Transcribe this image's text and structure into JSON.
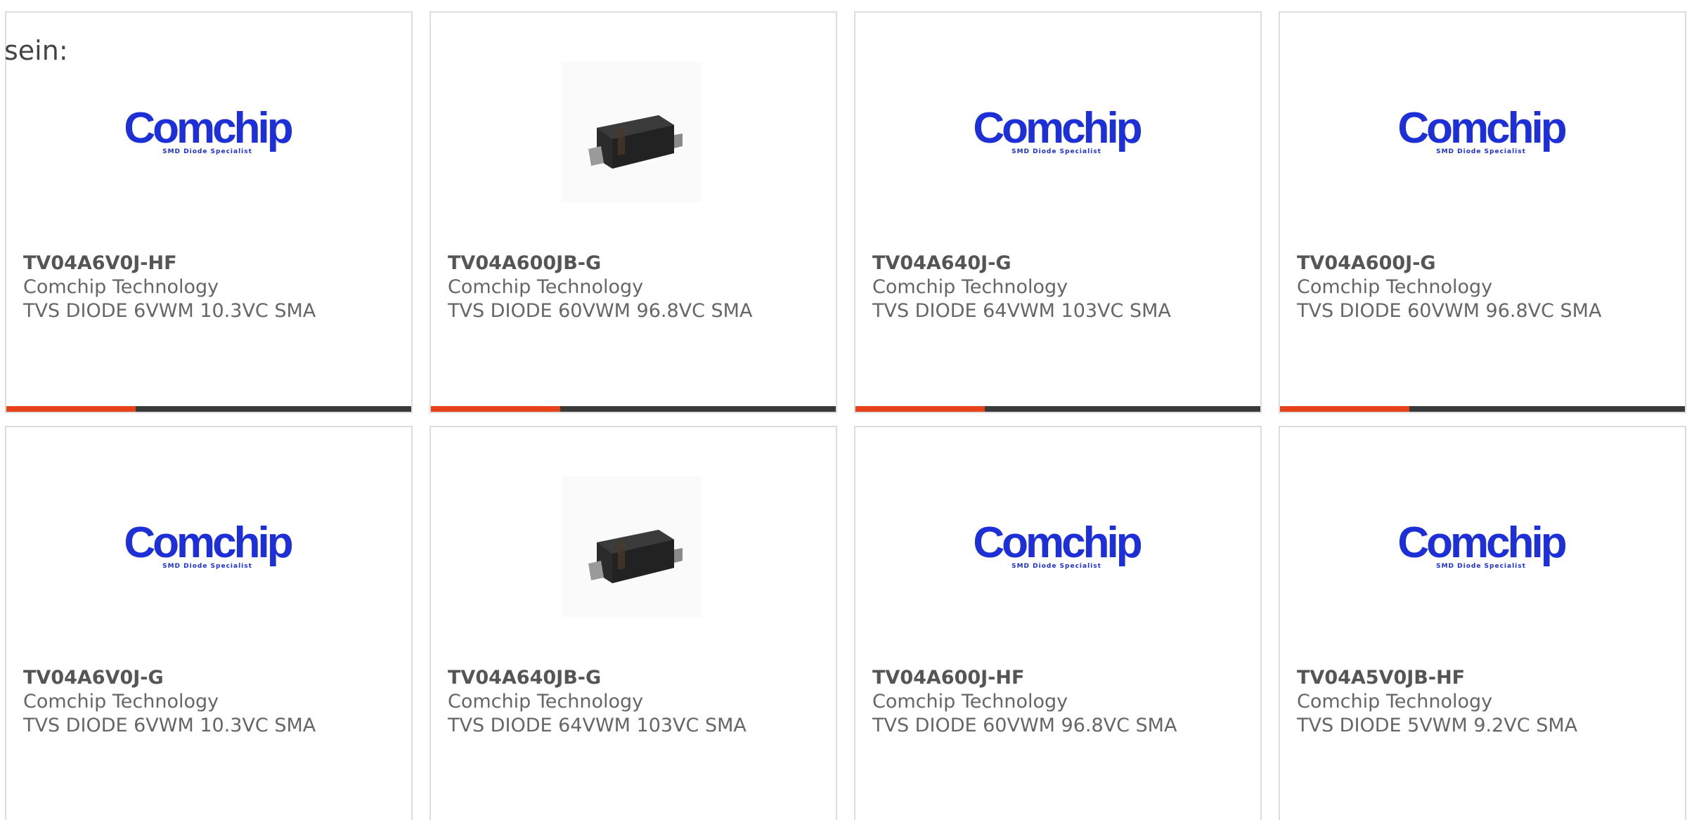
{
  "lead_text": "sein:",
  "accent_color": "#e8421b",
  "bar_color": "#3a3a3a",
  "logo_color": "#1d2fd6",
  "accent_fraction": 0.32,
  "cards": [
    {
      "image": "comchip-logo",
      "logo_word": "Comchip",
      "logo_tag": "SMD Diode Specialist",
      "part_number": "TV04A6V0J-HF",
      "manufacturer": "Comchip Technology",
      "description": "TVS DIODE 6VWM 10.3VC SMA"
    },
    {
      "image": "sma-diode-photo",
      "logo_word": "",
      "logo_tag": "",
      "part_number": "TV04A600JB-G",
      "manufacturer": "Comchip Technology",
      "description": "TVS DIODE 60VWM 96.8VC SMA"
    },
    {
      "image": "comchip-logo",
      "logo_word": "Comchip",
      "logo_tag": "SMD Diode Specialist",
      "part_number": "TV04A640J-G",
      "manufacturer": "Comchip Technology",
      "description": "TVS DIODE 64VWM 103VC SMA"
    },
    {
      "image": "comchip-logo",
      "logo_word": "Comchip",
      "logo_tag": "SMD Diode Specialist",
      "part_number": "TV04A600J-G",
      "manufacturer": "Comchip Technology",
      "description": "TVS DIODE 60VWM 96.8VC SMA"
    },
    {
      "image": "comchip-logo",
      "logo_word": "Comchip",
      "logo_tag": "SMD Diode Specialist",
      "part_number": "TV04A6V0J-G",
      "manufacturer": "Comchip Technology",
      "description": "TVS DIODE 6VWM 10.3VC SMA"
    },
    {
      "image": "sma-diode-photo",
      "logo_word": "",
      "logo_tag": "",
      "part_number": "TV04A640JB-G",
      "manufacturer": "Comchip Technology",
      "description": "TVS DIODE 64VWM 103VC SMA"
    },
    {
      "image": "comchip-logo",
      "logo_word": "Comchip",
      "logo_tag": "SMD Diode Specialist",
      "part_number": "TV04A600J-HF",
      "manufacturer": "Comchip Technology",
      "description": "TVS DIODE 60VWM 96.8VC SMA"
    },
    {
      "image": "comchip-logo",
      "logo_word": "Comchip",
      "logo_tag": "SMD Diode Specialist",
      "part_number": "TV04A5V0JB-HF",
      "manufacturer": "Comchip Technology",
      "description": "TVS DIODE 5VWM 9.2VC SMA"
    }
  ]
}
